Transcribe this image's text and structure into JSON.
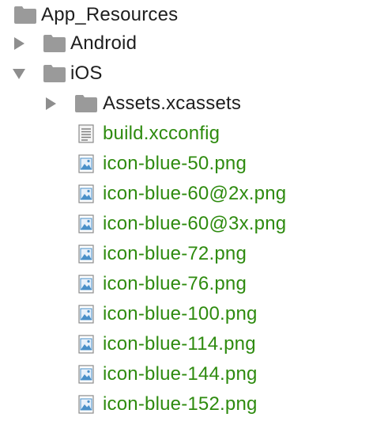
{
  "tree": {
    "root": {
      "name": "App_Resources",
      "icon": "folder-icon",
      "expanded": true
    },
    "android": {
      "name": "Android",
      "icon": "folder-icon",
      "expanded": false
    },
    "ios": {
      "name": "iOS",
      "icon": "folder-icon",
      "expanded": true
    },
    "assets": {
      "name": "Assets.xcassets",
      "icon": "folder-icon",
      "expanded": false
    },
    "files": [
      {
        "name": "build.xcconfig",
        "icon": "text-file-icon"
      },
      {
        "name": "icon-blue-50.png",
        "icon": "image-file-icon"
      },
      {
        "name": "icon-blue-60@2x.png",
        "icon": "image-file-icon"
      },
      {
        "name": "icon-blue-60@3x.png",
        "icon": "image-file-icon"
      },
      {
        "name": "icon-blue-72.png",
        "icon": "image-file-icon"
      },
      {
        "name": "icon-blue-76.png",
        "icon": "image-file-icon"
      },
      {
        "name": "icon-blue-100.png",
        "icon": "image-file-icon"
      },
      {
        "name": "icon-blue-114.png",
        "icon": "image-file-icon"
      },
      {
        "name": "icon-blue-144.png",
        "icon": "image-file-icon"
      },
      {
        "name": "icon-blue-152.png",
        "icon": "image-file-icon"
      }
    ]
  },
  "colors": {
    "folder": "#9a9a9a",
    "arrow": "#8e8e8e",
    "directory_text": "#1e1e1e",
    "file_text": "#2e8b0f",
    "image_icon_accent": "#4a90c9"
  }
}
